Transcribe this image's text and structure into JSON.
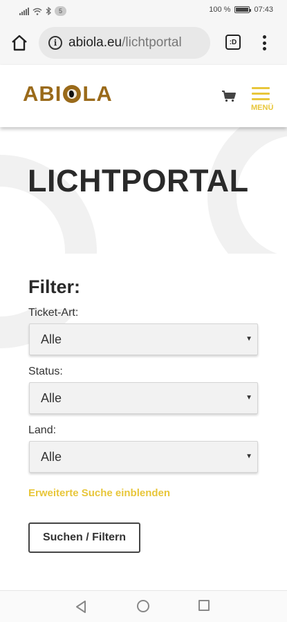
{
  "statusbar": {
    "notification_count": "5",
    "battery_percent": "100 %",
    "battery_level": 1.0,
    "time": "07:43"
  },
  "browser": {
    "url_host": "abiola.eu",
    "url_path": "/lichtportal",
    "tabs_label": ":D",
    "icons": [
      "home-icon",
      "info-icon",
      "tabs-icon",
      "more-vert-icon"
    ]
  },
  "header": {
    "logo_text_left": "ABI",
    "logo_text_right": "LA",
    "menu_label": "MENÜ",
    "icons": [
      "cart-icon",
      "hamburger-icon"
    ],
    "accent_color": "#e8c63a",
    "brand_color": "#9a6a1a"
  },
  "main": {
    "title": "LICHTPORTAL",
    "filter_heading": "Filter:",
    "fields": [
      {
        "label": "Ticket-Art:",
        "value": "Alle"
      },
      {
        "label": "Status:",
        "value": "Alle"
      },
      {
        "label": "Land:",
        "value": "Alle"
      }
    ],
    "advanced_search_link": "Erweiterte Suche einblenden",
    "submit_label": "Suchen / Filtern"
  },
  "navbar": {
    "icons": [
      "back-icon",
      "home-circle-icon",
      "recents-icon"
    ]
  }
}
